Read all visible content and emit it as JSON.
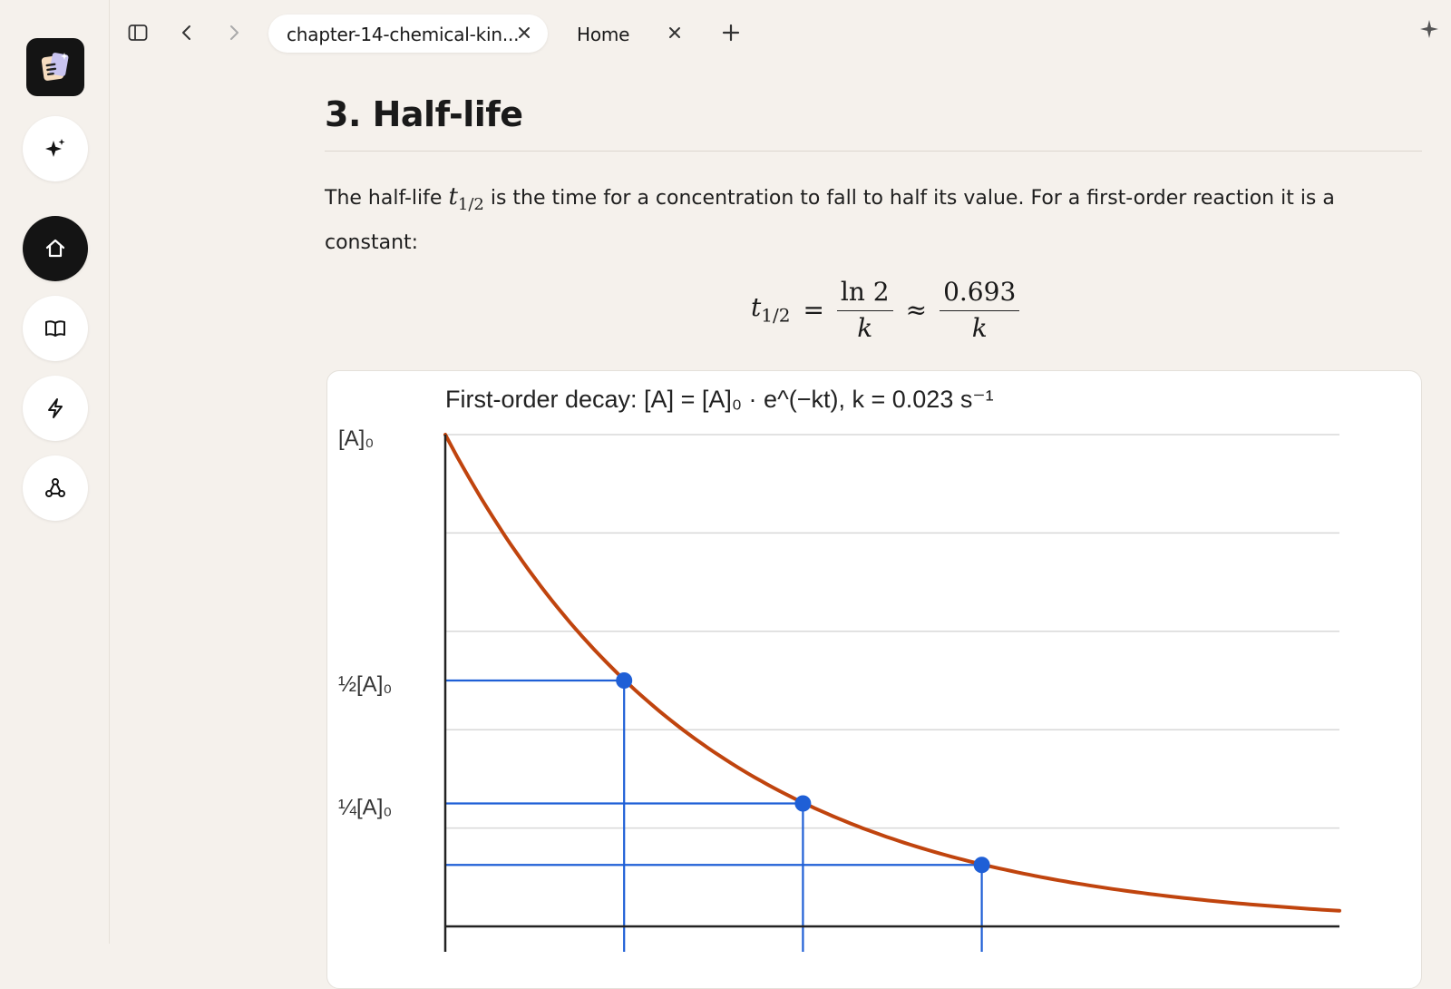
{
  "tabs": [
    {
      "label": "chapter-14-chemical-kin...",
      "active": true
    },
    {
      "label": "Home",
      "active": false
    }
  ],
  "icons": {
    "sidebar_toggle": "sidebar-toggle-icon",
    "back": "chevron-left-icon",
    "forward": "chevron-right-icon",
    "new_tab": "plus-icon",
    "assistant": "sparkle-icon"
  },
  "sidebar": {
    "items": [
      {
        "name": "ai-assistant",
        "icon": "sparkle-icon",
        "active": false
      },
      {
        "name": "home",
        "icon": "home-icon",
        "active": true
      },
      {
        "name": "library",
        "icon": "book-icon",
        "active": false
      },
      {
        "name": "quick-actions",
        "icon": "lightning-icon",
        "active": false
      },
      {
        "name": "graph",
        "icon": "graph-icon",
        "active": false
      }
    ]
  },
  "section": {
    "heading": "3. Half-life",
    "para_before": "The half-life ",
    "para_var": "t",
    "para_sub": "1/2",
    "para_after": " is the time for a concentration to fall to half its value. For a first-order reaction it is a constant:"
  },
  "formula": {
    "lhs_var": "t",
    "lhs_sub": "1/2",
    "eq": "=",
    "frac1_num": "ln 2",
    "frac1_den": "k",
    "approx": "≈",
    "frac2_num": "0.693",
    "frac2_den": "k"
  },
  "colors": {
    "curve": "#c0440e",
    "guides": "#1f5fd6",
    "accent_dark": "#141414"
  },
  "chart_data": {
    "type": "line",
    "title": "First-order decay:   [A] = [A]₀ · e^(−kt),   k = 0.023 s⁻¹",
    "k": 0.023,
    "x_range": [
      0,
      150
    ],
    "y_range": [
      0,
      1
    ],
    "ytick_labels": [
      {
        "label": "[A]₀",
        "value": 1
      },
      {
        "label": "½[A]₀",
        "value": 0.5
      },
      {
        "label": "¼[A]₀",
        "value": 0.25
      }
    ],
    "gridlines_y": [
      1.0,
      0.8,
      0.6,
      0.4,
      0.2
    ],
    "markers": [
      {
        "t": 30,
        "y": 0.5
      },
      {
        "t": 60,
        "y": 0.25
      },
      {
        "t": 90,
        "y": 0.125
      }
    ],
    "grid": true,
    "legend": "none"
  }
}
